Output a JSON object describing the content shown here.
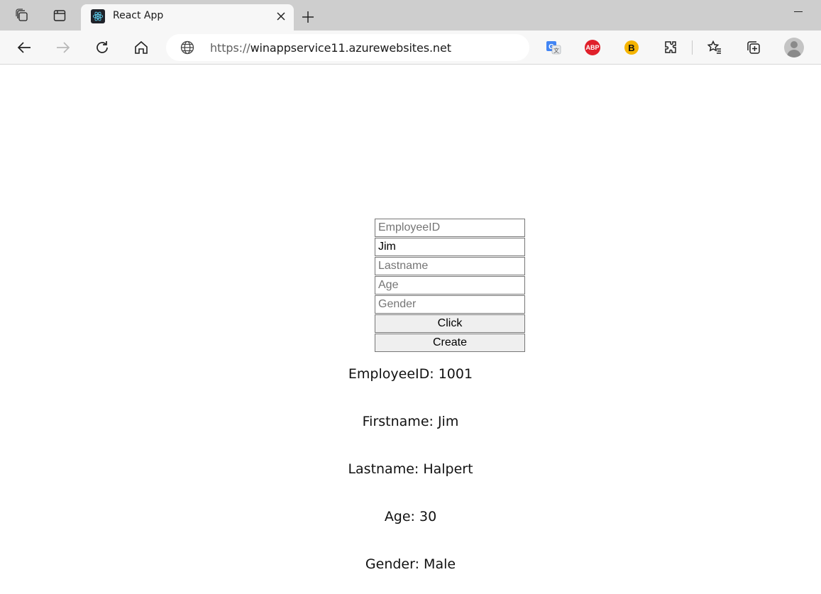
{
  "browser": {
    "tab": {
      "title": "React App",
      "favicon": "react-logo-icon"
    },
    "address": {
      "protocol": "https://",
      "host": "winappservice11.azurewebsites.net"
    },
    "extensions": {
      "abp_label": "ABP",
      "b_label": "B"
    }
  },
  "form": {
    "employee_id": {
      "placeholder": "EmployeeID",
      "value": ""
    },
    "firstname": {
      "placeholder": "",
      "value": "Jim"
    },
    "lastname": {
      "placeholder": "Lastname",
      "value": ""
    },
    "age": {
      "placeholder": "Age",
      "value": ""
    },
    "gender": {
      "placeholder": "Gender",
      "value": ""
    },
    "click_label": "Click",
    "create_label": "Create"
  },
  "result": {
    "employee_id": "EmployeeID: 1001",
    "firstname": "Firstname: Jim",
    "lastname": "Lastname: Halpert",
    "age": "Age: 30",
    "gender": "Gender: Male"
  },
  "colors": {
    "abp": "#e0202a",
    "b_ext": "#f5b400",
    "tabstrip": "#cecece",
    "toolbar": "#f7f7f7"
  }
}
